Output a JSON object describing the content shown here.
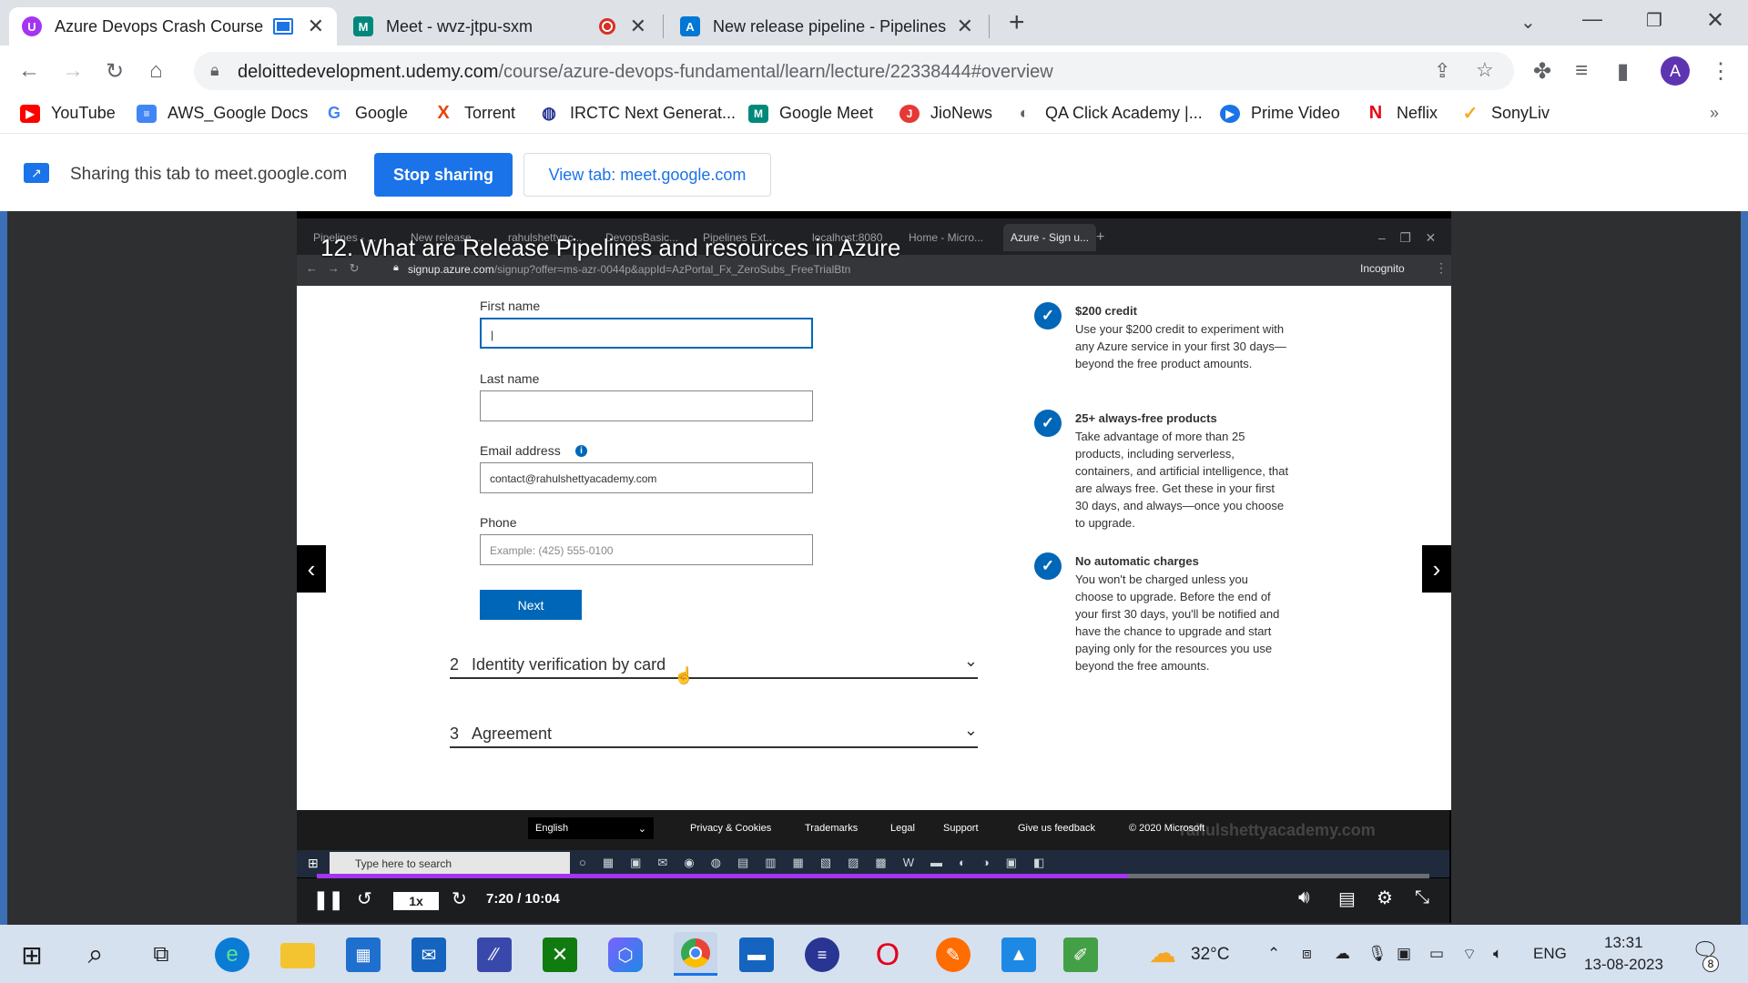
{
  "tabs": [
    {
      "title": "Azure Devops Crash Course",
      "active": true,
      "icon": "udemy-icon",
      "icon_color": "#a435f0",
      "icon_glyph": "U"
    },
    {
      "title": "Meet - wvz-jtpu-sxm",
      "active": false,
      "icon": "google-meet-icon",
      "icon_color": "#00897b",
      "icon_glyph": "M"
    },
    {
      "title": "New release pipeline - Pipelines",
      "active": false,
      "icon": "azure-devops-icon",
      "icon_color": "#0078d4",
      "icon_glyph": "A"
    }
  ],
  "new_tab_label": "+",
  "address": {
    "domain": "deloittedevelopment.udemy.com",
    "path": "/course/azure-devops-fundamental/learn/lecture/22338444#overview"
  },
  "profile_initial": "A",
  "bookmarks": [
    {
      "label": "YouTube",
      "color": "#ff0000",
      "glyph": "▶"
    },
    {
      "label": "AWS_Google Docs",
      "color": "#4285f4",
      "glyph": "≡"
    },
    {
      "label": "Google",
      "color": "#ffffff",
      "glyph": "G"
    },
    {
      "label": "Torrent",
      "color": "#ffffff",
      "glyph": "X"
    },
    {
      "label": "IRCTC Next Generat...",
      "color": "#ffffff",
      "glyph": "◍"
    },
    {
      "label": "Google Meet",
      "color": "#00897b",
      "glyph": "M"
    },
    {
      "label": "JioNews",
      "color": "#e53935",
      "glyph": "J"
    },
    {
      "label": "QA Click Academy |...",
      "color": "#5f6368",
      "glyph": "◐"
    },
    {
      "label": "Prime Video",
      "color": "#1a73e8",
      "glyph": "▶"
    },
    {
      "label": "Neflix",
      "color": "#ffffff",
      "glyph": "N"
    },
    {
      "label": "SonyLiv",
      "color": "#ffffff",
      "glyph": "✓"
    }
  ],
  "bookmarks_more": "»",
  "share": {
    "text": "Sharing this tab to meet.google.com",
    "stop_label": "Stop sharing",
    "view_label": "View tab: meet.google.com"
  },
  "lecture": {
    "title": "12. What are Release Pipelines and resources in Azure"
  },
  "inner_browser": {
    "tabs": [
      "Pipelines - ...",
      "New release ...",
      "rahulshettyac...",
      "DevopsBasic...",
      "Pipelines Ext...",
      "localhost:8080",
      "Home - Micro...",
      "Azure - Sign u..."
    ],
    "url_domain": "signup.azure.com",
    "url_path": "/signup?offer=ms-azr-0044p&appId=AzPortal_Fx_ZeroSubs_FreeTrialBtn",
    "incognito_label": "Incognito"
  },
  "form": {
    "first_name_label": "First name",
    "first_name_value": "|",
    "last_name_label": "Last name",
    "last_name_value": "",
    "email_label": "Email address",
    "email_value": "contact@rahulshettyacademy.com",
    "phone_label": "Phone",
    "phone_placeholder": "Example: (425) 555-0100",
    "next_label": "Next"
  },
  "steps": [
    {
      "num": "2",
      "label": "Identity verification by card"
    },
    {
      "num": "3",
      "label": "Agreement"
    }
  ],
  "benefits": [
    {
      "title": "$200 credit",
      "text": "Use your $200 credit to experiment with any Azure service in your first 30 days—beyond the free product amounts."
    },
    {
      "title": "25+ always-free products",
      "text": "Take advantage of more than 25 products, including serverless, containers, and artificial intelligence, that are always free. Get these in your first 30 days, and always—once you choose to upgrade."
    },
    {
      "title": "No automatic charges",
      "text": "You won't be charged unless you choose to upgrade. Before the end of your first 30 days, you'll be notified and have the chance to upgrade and start paying only for the resources you use beyond the free amounts."
    }
  ],
  "footer": {
    "language": "English",
    "links": [
      "Privacy & Cookies",
      "Trademarks",
      "Legal",
      "Support",
      "Give us feedback",
      "© 2020 Microsoft"
    ],
    "watermark": "rahulshettyacademy.com"
  },
  "inner_taskbar": {
    "search_placeholder": "Type here to search"
  },
  "player": {
    "speed": "1x",
    "time": "7:20 / 10:04",
    "progress": 0.729
  },
  "system": {
    "weather": "32°C",
    "lang": "ENG",
    "time": "13:31",
    "date": "13-08-2023",
    "notifications": "8"
  }
}
